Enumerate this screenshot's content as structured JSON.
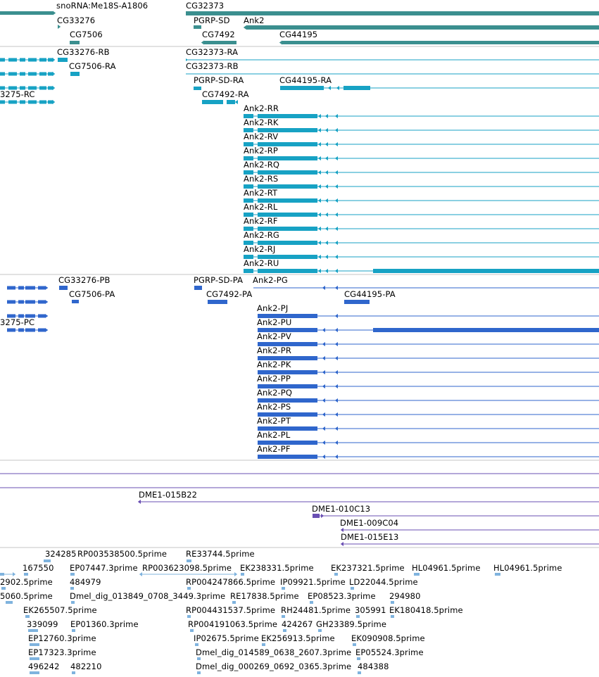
{
  "colors": {
    "gene": "#3b8f8f",
    "mrna": "#17a2c4",
    "cds": "#2f66cc",
    "clone": "#6a4fb3",
    "est": "#7fb3de",
    "divider": "#c4c4c4"
  },
  "gene_track": {
    "labels": [
      "snoRNA:Me18S-A1806",
      "CG32373",
      "CG33276",
      "PGRP-SD",
      "Ank2",
      "CG7506",
      "CG7492",
      "CG44195"
    ]
  },
  "mrna_track": {
    "labels": [
      "CG33276-RB",
      "CG32373-RA",
      "CG7506-RA",
      "CG32373-RB",
      "PGRP-SD-RA",
      "CG44195-RA",
      "3275-RC",
      "CG7492-RA",
      "Ank2-RR",
      "Ank2-RK",
      "Ank2-RV",
      "Ank2-RP",
      "Ank2-RQ",
      "Ank2-RS",
      "Ank2-RT",
      "Ank2-RL",
      "Ank2-RF",
      "Ank2-RG",
      "Ank2-RJ",
      "Ank2-RU"
    ]
  },
  "cds_track": {
    "labels": [
      "CG33276-PB",
      "PGRP-SD-PA",
      "Ank2-PG",
      "CG7506-PA",
      "CG7492-PA",
      "CG44195-PA",
      "Ank2-PJ",
      "3275-PC",
      "Ank2-PU",
      "Ank2-PV",
      "Ank2-PR",
      "Ank2-PK",
      "Ank2-PP",
      "Ank2-PQ",
      "Ank2-PS",
      "Ank2-PT",
      "Ank2-PL",
      "Ank2-PF"
    ]
  },
  "clone_track": {
    "labels": [
      "DME1-015B22",
      "DME1-010C13",
      "DME1-009C04",
      "DME1-015E13"
    ]
  },
  "est_track": {
    "labels": [
      "324285",
      "RP003538500.5prime",
      "RE33744.5prime",
      "167550",
      "EP07447.3prime",
      "RP003623098.5prime",
      "EK238331.5prime",
      "EK237321.5prime",
      "HL04961.5prime",
      "HL04961.5prime",
      "2902.5prime",
      "484979",
      "RP004247866.5prime",
      "IP09921.5prime",
      "LD22044.5prime",
      "5060.5prime",
      "Dmel_dig_013849_0708_3449.3prime",
      "RE17838.5prime",
      "EP08523.3prime",
      "294980",
      "EK265507.5prime",
      "RP004431537.5prime",
      "RH24481.5prime",
      "305991",
      "EK180418.5prime",
      "339099",
      "EP01360.3prime",
      "RP004191063.5prime",
      "424267",
      "GH23389.5prime",
      "EP12760.3prime",
      "IP02675.5prime",
      "EK256913.5prime",
      "EK090908.5prime",
      "EP17323.3prime",
      "Dmel_dig_014589_0638_2607.3prime",
      "EP05524.3prime",
      "496242",
      "482210",
      "Dmel_dig_000269_0692_0365.3prime",
      "484388"
    ]
  }
}
